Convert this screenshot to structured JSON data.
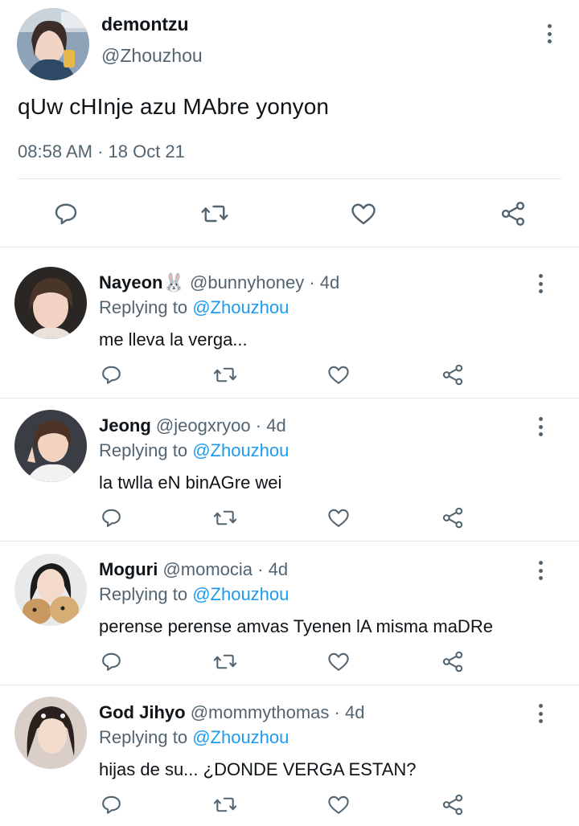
{
  "main_tweet": {
    "display_name": "demontzu",
    "handle": "@Zhouzhou",
    "text": "qUw cHInje azu MAbre yonyon",
    "timestamp": "08:58 AM · 18 Oct 21",
    "actions": [
      "reply-icon",
      "retweet-icon",
      "like-icon",
      "share-icon"
    ]
  },
  "replies": [
    {
      "display_name": "Nayeon🐰",
      "handle": "@bunnyhoney",
      "age": "· 4d",
      "replying_label": "Replying to",
      "replying_to": "@Zhouzhou",
      "text": "me lleva la verga..."
    },
    {
      "display_name": "Jeong",
      "handle": "@jeogxryoo",
      "age": "· 4d",
      "replying_label": "Replying to",
      "replying_to": "@Zhouzhou",
      "text": "la twlla eN binAGre wei"
    },
    {
      "display_name": "Moguri",
      "handle": "@momocia",
      "age": "· 4d",
      "replying_label": "Replying to",
      "replying_to": "@Zhouzhou",
      "text": "perense perense amvas Tyenen lA misma maDRe"
    },
    {
      "display_name": "God Jihyo",
      "handle": "@mommythomas",
      "age": "· 4d",
      "replying_label": "Replying to",
      "replying_to": "@Zhouzhou",
      "text": "hijas de su... ¿DONDE VERGA ESTAN?"
    }
  ],
  "colors": {
    "text_primary": "#0f1419",
    "text_secondary": "#536471",
    "link": "#1d9bf0",
    "divider": "#e6e9ec"
  }
}
